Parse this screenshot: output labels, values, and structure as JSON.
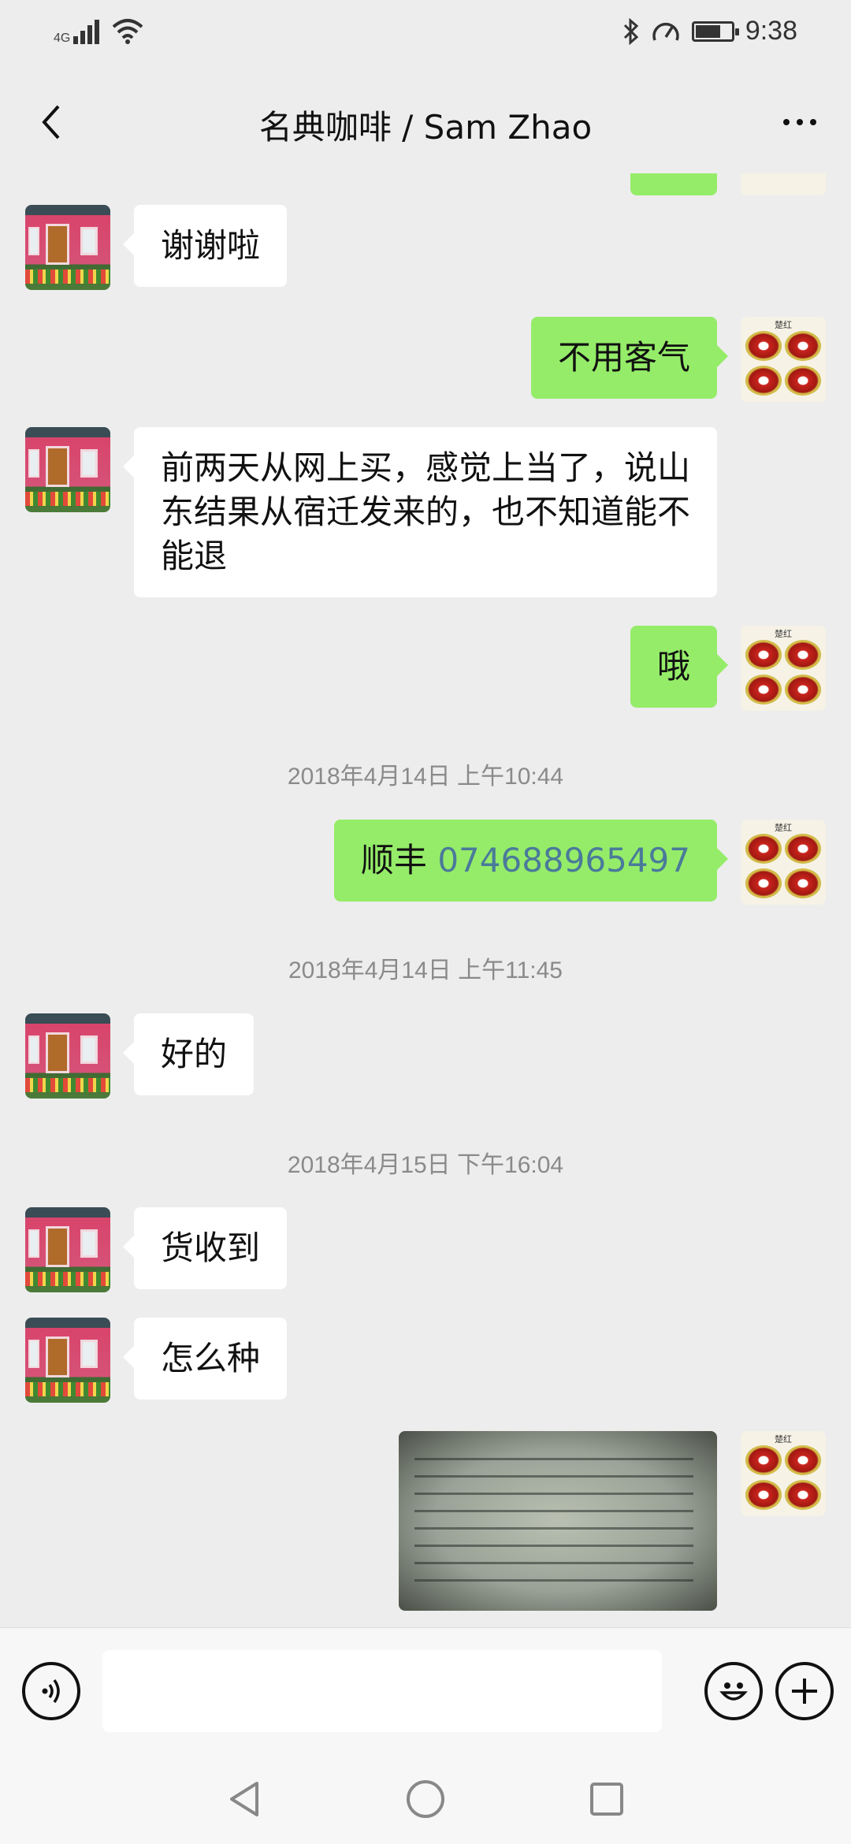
{
  "status_bar": {
    "network": "4G",
    "time": "9:38",
    "battery_level": 0.7
  },
  "header": {
    "title": "名典咖啡 / Sam Zhao",
    "back_icon": "chevron-left-icon",
    "more_icon": "more-icon"
  },
  "messages": [
    {
      "side": "in",
      "text": "谢谢啦"
    },
    {
      "side": "out",
      "text": "不用客气"
    },
    {
      "side": "in",
      "text": "前两天从网上买，感觉上当了，说山东结果从宿迁发来的，也不知道能不能退"
    },
    {
      "side": "out",
      "text": "哦"
    },
    {
      "type": "time",
      "text": "2018年4月14日 上午10:44"
    },
    {
      "side": "out",
      "prefix": "顺丰 ",
      "tracking": "074688965497"
    },
    {
      "type": "time",
      "text": "2018年4月14日 上午11:45"
    },
    {
      "side": "in",
      "text": "好的"
    },
    {
      "type": "time",
      "text": "2018年4月15日 下午16:04"
    },
    {
      "side": "in",
      "text": "货收到"
    },
    {
      "side": "in",
      "text": "怎么种"
    },
    {
      "side": "out",
      "type": "image"
    }
  ],
  "avatars": {
    "contact_label": "",
    "self_label": "楚红"
  },
  "input_bar": {
    "voice_icon": "voice-icon",
    "emoji_icon": "emoji-icon",
    "plus_icon": "plus-icon",
    "placeholder": ""
  },
  "system_nav": [
    "back-triangle-icon",
    "home-circle-icon",
    "recent-square-icon"
  ]
}
